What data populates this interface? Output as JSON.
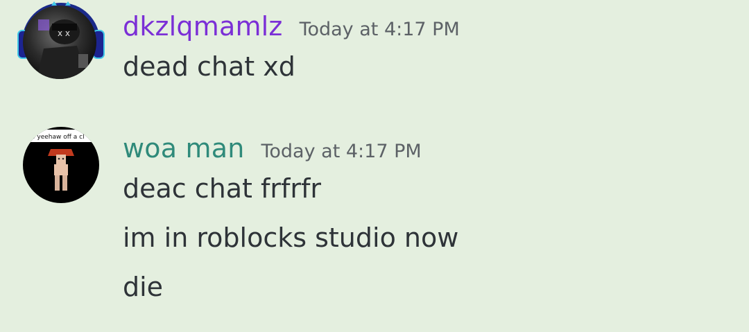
{
  "messages": [
    {
      "username": "dkzlqmamlz",
      "username_color": "#7b2fd6",
      "timestamp": "Today at 4:17 PM",
      "lines": [
        "dead chat xd"
      ],
      "avatar": "dark-character-avatar-with-headphones-frame"
    },
    {
      "username": "woa man",
      "username_color": "#2f8a7a",
      "timestamp": "Today at 4:17 PM",
      "lines": [
        "deac chat frfrfr",
        "im in roblocks studio now",
        "die"
      ],
      "avatar": "roblox-character-avatar",
      "avatar_caption": "o yeehaw off a cl"
    }
  ]
}
